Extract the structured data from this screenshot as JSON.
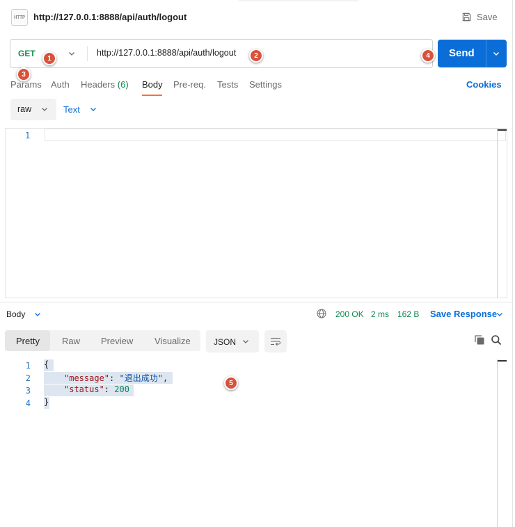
{
  "title": {
    "url": "http://127.0.0.1:8888/api/auth/logout",
    "http_badge": "HTTP",
    "save_label": "Save"
  },
  "request": {
    "method": "GET",
    "url": "http://127.0.0.1:8888/api/auth/logout",
    "send_label": "Send",
    "tabs": [
      {
        "label": "Params"
      },
      {
        "label": "Auth"
      },
      {
        "label": "Headers",
        "count": "(6)"
      },
      {
        "label": "Body"
      },
      {
        "label": "Pre-req."
      },
      {
        "label": "Tests"
      },
      {
        "label": "Settings"
      }
    ],
    "active_tab": "Body",
    "cookies_label": "Cookies",
    "body_mode": "raw",
    "body_format": "Text",
    "editor_line_numbers": [
      "1"
    ]
  },
  "markers": [
    "1",
    "2",
    "3",
    "4",
    "5"
  ],
  "response": {
    "section_label": "Body",
    "status": "200 OK",
    "time": "2 ms",
    "size": "162 B",
    "save_label": "Save Response",
    "view_tabs": [
      "Pretty",
      "Raw",
      "Preview",
      "Visualize"
    ],
    "active_view": "Pretty",
    "format": "JSON",
    "line_numbers": [
      "1",
      "2",
      "3",
      "4"
    ],
    "code": {
      "open": "{",
      "key1": "\"message\"",
      "val1": "\"退出成功\"",
      "key2": "\"status\"",
      "val2": "200",
      "close": "}"
    }
  },
  "colors": {
    "accent": "#0b6ed8",
    "method_green": "#0b8a4d",
    "active_tab_underline": "#ff6c37",
    "marker": "#d9523b"
  },
  "icons": [
    "http-file-icon",
    "save-icon",
    "chevron-down-icon",
    "globe-icon",
    "wrap-lines-icon",
    "copy-icon",
    "search-icon"
  ]
}
